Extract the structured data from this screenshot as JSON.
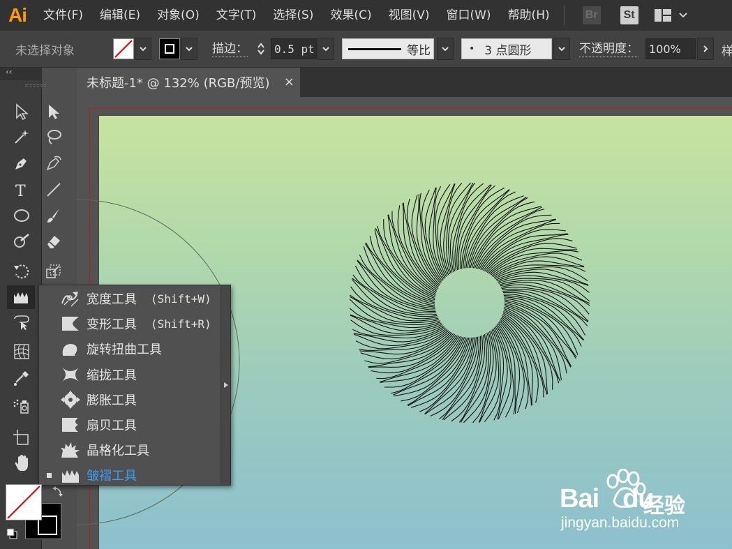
{
  "app": {
    "logo": "Ai",
    "menus": [
      "文件(F)",
      "编辑(E)",
      "对象(O)",
      "文字(T)",
      "选择(S)",
      "效果(C)",
      "视图(V)",
      "窗口(W)",
      "帮助(H)"
    ],
    "badges": {
      "bridge": "Br",
      "stock": "St"
    }
  },
  "control_bar": {
    "selection_status": "未选择对象",
    "stroke_label": "描边：",
    "stroke_weight": "0.5 pt",
    "profile_label": "等比",
    "brush_label": "3 点圆形",
    "brush_dot": "•",
    "opacity_label": "不透明度：",
    "opacity_value": "100%",
    "style_label_partial": "样"
  },
  "toolbox": {
    "collapse_glyph": "‹‹"
  },
  "document": {
    "tab_title": "未标题-1* @ 132% (RGB/预览)",
    "tab_close": "×"
  },
  "flyout": {
    "items": [
      {
        "label": "宽度工具",
        "shortcut": "(Shift+W)",
        "icon": "width-tool-icon"
      },
      {
        "label": "变形工具",
        "shortcut": "(Shift+R)",
        "icon": "warp-tool-icon"
      },
      {
        "label": "旋转扭曲工具",
        "shortcut": "",
        "icon": "twirl-tool-icon"
      },
      {
        "label": "缩拢工具",
        "shortcut": "",
        "icon": "pucker-tool-icon"
      },
      {
        "label": "膨胀工具",
        "shortcut": "",
        "icon": "bloat-tool-icon"
      },
      {
        "label": "扇贝工具",
        "shortcut": "",
        "icon": "scallop-tool-icon"
      },
      {
        "label": "晶格化工具",
        "shortcut": "",
        "icon": "crystallize-tool-icon"
      },
      {
        "label": "皱褶工具",
        "shortcut": "",
        "icon": "wrinkle-tool-icon",
        "selected": true
      }
    ],
    "selected_color": "#3d9cf0"
  },
  "watermark": {
    "brand": "Bai",
    "brand_suffix": "du",
    "cn": "经验",
    "url": "jingyan.baidu.com"
  },
  "colors": {
    "accent_orange": "#ff9a00",
    "artboard_top": "#c7e39f",
    "artboard_bottom": "#8cbfd0",
    "artboard_border": "#b51e1e"
  }
}
